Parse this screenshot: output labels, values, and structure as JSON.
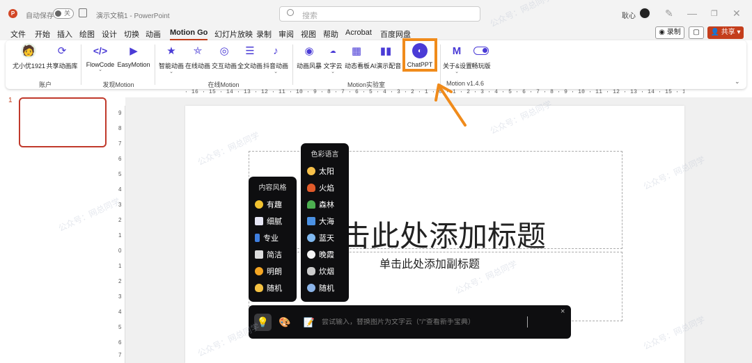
{
  "titlebar": {
    "logo_letter": "P",
    "autosave_label": "自动保存",
    "autosave_state": "关",
    "doc_title": "演示文稿1 - PowerPoint",
    "search_placeholder": "搜索",
    "user_name": "耿心"
  },
  "tabs": [
    "文件",
    "开始",
    "插入",
    "绘图",
    "设计",
    "切换",
    "动画",
    "Motion Go",
    "幻灯片放映",
    "录制",
    "审阅",
    "视图",
    "帮助",
    "Acrobat",
    "百度网盘"
  ],
  "active_tab": "Motion Go",
  "right_actions": {
    "record_label": "◉ 录制",
    "comment_label": "▢",
    "share_label": "共享"
  },
  "ribbon": {
    "buttons": {
      "account": "尤小优1921",
      "share_lib": "共享动画库",
      "flowcode": "FlowCode",
      "easymotion": "EasyMotion",
      "smart_anim": "智能动画",
      "online_anim": "在线动画",
      "interactive_anim": "交互动画",
      "full_text_anim": "全文动画",
      "douyin_anim": "抖音动画",
      "anim_style": "动画风暴",
      "word_cloud": "文字云",
      "dynamic_board": "动态看板",
      "ai_voice": "AI演示配音",
      "chatppt": "ChatPPT",
      "about_settings": "关于&设置",
      "play_mode": "畅玩版"
    },
    "groups": {
      "account": "账户",
      "discover": "发现Motion",
      "online": "在线Motion",
      "lab": "Motion实验室",
      "version": "Motion v1.4.6"
    }
  },
  "ruler_text": "· 16 · 15 · 14 · 13 · 12 · 11 · 10 · 9 · 8 · 7 · 6 · 5 · 4 · 3 · 2 · 1 · 0 · 1 · 2 · 3 · 4 · 5 · 6 · 7 · 8 · 9 · 10 · 11 · 12 · 13 · 14 · 15 · 16 ·",
  "vruler": [
    "9",
    "8",
    "7",
    "6",
    "5",
    "4",
    "3",
    "2",
    "1",
    "0",
    "1",
    "2",
    "3",
    "4",
    "5",
    "6",
    "7"
  ],
  "thumbnail_number": "1",
  "slide": {
    "title_placeholder": "单击此处添加标题",
    "title_visible": "击此处添加标题",
    "subtitle_placeholder": "单击此处添加副标题"
  },
  "content_style_menu": {
    "header": "内容风格",
    "items": [
      "有趣",
      "细腻",
      "专业",
      "简洁",
      "明朗",
      "随机"
    ]
  },
  "color_menu": {
    "header": "色彩语言",
    "items": [
      "太阳",
      "火焰",
      "森林",
      "大海",
      "蓝天",
      "晚霞",
      "炊烟",
      "随机"
    ]
  },
  "chatbar": {
    "input_placeholder": "尝试输入，替换图片为文字云（\"/\"查看新手宝典）",
    "close_label": "×"
  },
  "watermark": "公众号：网总同学",
  "colors": {
    "accent": "#c43e1c",
    "highlight": "#f08b1b",
    "dark_panel": "#0e0e10"
  }
}
